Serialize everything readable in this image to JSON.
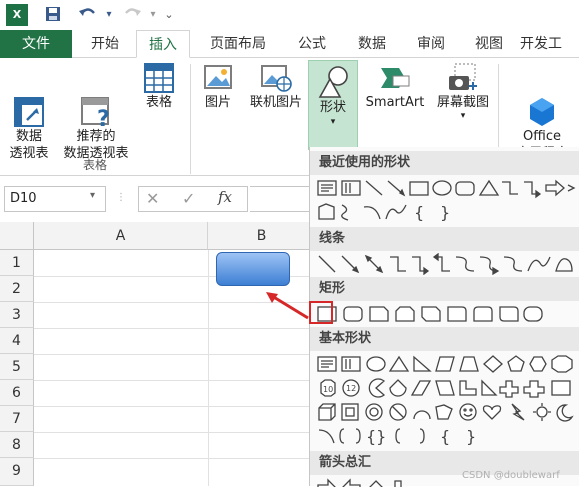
{
  "quick_access": {
    "excel_logo": "X",
    "save_icon": "save-icon",
    "undo_icon": "undo-icon",
    "redo_icon": "redo-icon",
    "more": "⌄"
  },
  "tabs": [
    "文件",
    "开始",
    "插入",
    "页面布局",
    "公式",
    "数据",
    "审阅",
    "视图",
    "开发工"
  ],
  "ribbon": {
    "pivot_table": "数据\n透视表",
    "recommended_pivot": "推荐的\n数据透视表",
    "table": "表格",
    "group_tables": "表格",
    "picture": "图片",
    "online_picture": "联机图片",
    "shapes": "形状",
    "smartart": "SmartArt",
    "screenshot": "屏幕截图",
    "office_apps": "Office\n应用程序"
  },
  "formula_bar": {
    "name_box": "D10",
    "fx": "fx",
    "cancel": "✕",
    "confirm": "✓"
  },
  "grid": {
    "columns": [
      "A",
      "B"
    ],
    "rows": [
      "1",
      "2",
      "3",
      "4",
      "5",
      "6",
      "7",
      "8",
      "9"
    ]
  },
  "shapes_panel": {
    "recent": "最近使用的形状",
    "lines": "线条",
    "rectangles": "矩形",
    "basic": "基本形状",
    "arrows": "箭头总汇"
  },
  "watermark": "CSDN @doublewarf",
  "colors": {
    "excel_green": "#217346",
    "highlight_red": "#d62828",
    "shape_blue": "#3d7fd3"
  }
}
